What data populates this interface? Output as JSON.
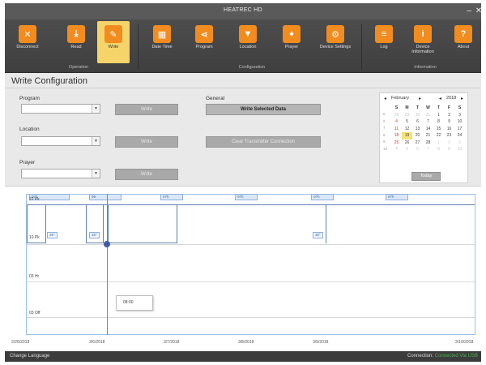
{
  "window": {
    "title": "HEATREC HD"
  },
  "ribbon": {
    "buttons": [
      {
        "label": "Disconnect",
        "icon": "x-icon",
        "glyph": "✕"
      },
      {
        "label": "Read",
        "icon": "cloud-download-icon",
        "glyph": "⤓"
      },
      {
        "label": "Write",
        "icon": "write-icon",
        "glyph": "✎"
      },
      {
        "label": "Date Time",
        "icon": "calendar-icon",
        "glyph": "▦"
      },
      {
        "label": "Program",
        "icon": "share-icon",
        "glyph": "⋖"
      },
      {
        "label": "Location",
        "icon": "location-icon",
        "glyph": "▼"
      },
      {
        "label": "Prayer",
        "icon": "hands-icon",
        "glyph": "♦"
      },
      {
        "label": "Device Settings",
        "icon": "gear-icon",
        "glyph": "⚙"
      },
      {
        "label": "Log",
        "icon": "log-icon",
        "glyph": "≡"
      },
      {
        "label": "Device Information",
        "icon": "info-icon",
        "glyph": "i"
      },
      {
        "label": "About",
        "icon": "about-icon",
        "glyph": "?"
      }
    ],
    "groups": [
      "Operation",
      "Configuration",
      "Information"
    ],
    "accent": "#f28c1e",
    "active_bg": "#f5d46a"
  },
  "panel": {
    "title": "Write Configuration",
    "program_label": "Program",
    "location_label": "Location",
    "prayer_label": "Prayer",
    "general_label": "General",
    "write_button": "Write",
    "write_selected_data": "Write Selected Data",
    "clear_transmitter": "Clear Transmitter Connection"
  },
  "calendar": {
    "month": "February",
    "year": "2018",
    "weekdays": [
      "S",
      "M",
      "T",
      "W",
      "T",
      "F",
      "S"
    ],
    "weeks": [
      [
        28,
        29,
        30,
        31,
        1,
        2,
        3
      ],
      [
        4,
        5,
        6,
        7,
        8,
        9,
        10
      ],
      [
        11,
        12,
        13,
        14,
        15,
        16,
        17
      ],
      [
        18,
        19,
        20,
        21,
        22,
        23,
        24
      ],
      [
        25,
        26,
        27,
        28,
        1,
        2,
        3
      ],
      [
        4,
        5,
        6,
        7,
        8,
        9,
        10
      ]
    ],
    "week_numbers": [
      "5",
      "6",
      "7",
      "8",
      "9",
      "10"
    ],
    "today": 19,
    "today_button": "Today"
  },
  "timeline": {
    "row_labels": [
      "22 Pk",
      "10 Pk",
      "03 Hr",
      "03 Off"
    ],
    "top_bars": [
      "07h",
      "09",
      "07h",
      "07h",
      "07h",
      "07h"
    ],
    "chips": [
      "35°",
      "35°",
      "35°"
    ],
    "tooltip": "08:00",
    "axis_labels": [
      "2/26/2018",
      "3/6/2018",
      "3/7/2018",
      "3/8/2018",
      "3/9/2018",
      "3/10/2018"
    ],
    "cursor_color": "#e04cc8"
  },
  "status": {
    "change_language": "Change Language",
    "connection_label": "Connection:",
    "connection_value": "Connected Via USB"
  }
}
